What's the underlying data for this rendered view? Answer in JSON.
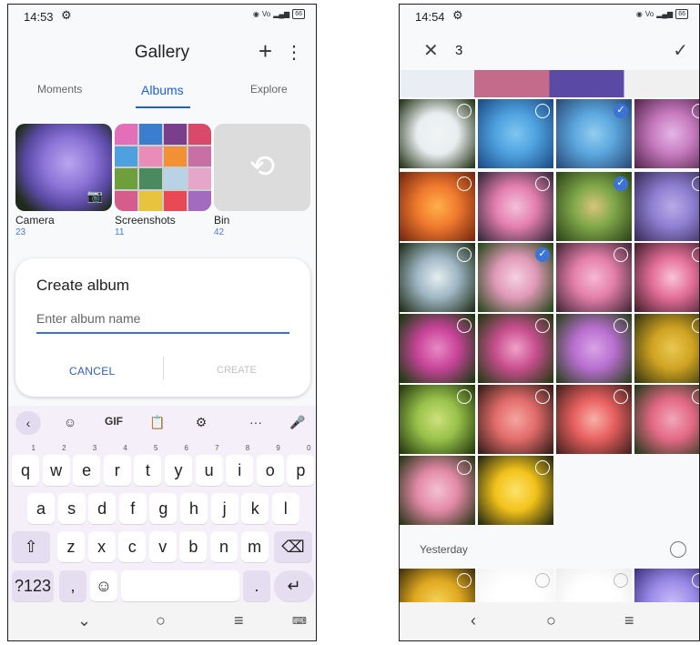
{
  "left": {
    "status": {
      "time": "14:53",
      "battery": "66"
    },
    "title": "Gallery",
    "tabs": [
      "Moments",
      "Albums",
      "Explore"
    ],
    "albums": [
      {
        "name": "Camera",
        "count": "23"
      },
      {
        "name": "Screenshots",
        "count": "11"
      },
      {
        "name": "Bin",
        "count": "42"
      }
    ],
    "dialog": {
      "title": "Create album",
      "placeholder": "Enter album name",
      "cancel": "CANCEL",
      "create": "CREATE"
    },
    "keyboard": {
      "toolbar": [
        "‹",
        "☺",
        "GIF",
        "📋",
        "⚙",
        "···",
        "🎤"
      ],
      "row1": [
        [
          "q",
          "1"
        ],
        [
          "w",
          "2"
        ],
        [
          "e",
          "3"
        ],
        [
          "r",
          "4"
        ],
        [
          "t",
          "5"
        ],
        [
          "y",
          "6"
        ],
        [
          "u",
          "7"
        ],
        [
          "i",
          "8"
        ],
        [
          "o",
          "9"
        ],
        [
          "p",
          "0"
        ]
      ],
      "row2": [
        "a",
        "s",
        "d",
        "f",
        "g",
        "h",
        "j",
        "k",
        "l"
      ],
      "row3": [
        "z",
        "x",
        "c",
        "v",
        "b",
        "n",
        "m"
      ],
      "sym": "?123",
      "comma": ",",
      "period": "."
    }
  },
  "right": {
    "status": {
      "time": "14:54",
      "battery": "66"
    },
    "selected_count": "3",
    "section": "Yesterday",
    "colors": {
      "accent": "#3b74d6"
    }
  }
}
